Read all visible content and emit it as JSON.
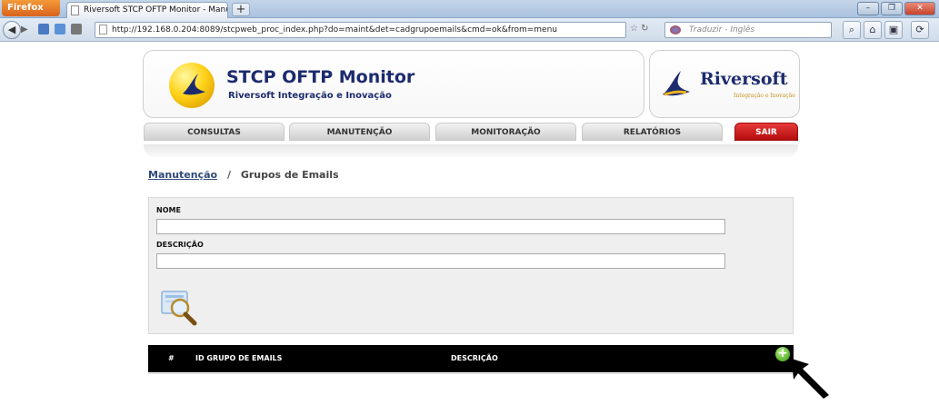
{
  "browser": {
    "firefox_button": "Firefox",
    "tab_title": "Riversoft STCP OFTP Monitor - Manuten...",
    "new_tab_label": "+",
    "url": "http://192.168.0.204:8089/stcpweb_proc_index.php?do=maint&det=cadgrupoemails&cmd=ok&from=menu",
    "search_placeholder": "Traduzir - Inglês"
  },
  "header": {
    "title": "STCP OFTP Monitor",
    "subtitle": "Riversoft Integração e Inovação",
    "partner_name": "Riversoft",
    "partner_tagline": "Integração e Inovação"
  },
  "menu": {
    "consultas": "CONSULTAS",
    "manutencao": "MANUTENÇÃO",
    "monitoracao": "MONITORAÇÃO",
    "relatorios": "RELATÓRIOS",
    "sair": "SAIR"
  },
  "breadcrumb": {
    "parent": "Manutenção",
    "separator": "/",
    "current": "Grupos de Emails"
  },
  "form": {
    "nome_label": "NOME",
    "nome_value": "",
    "descricao_label": "DESCRIÇÃO",
    "descricao_value": ""
  },
  "table": {
    "columns": [
      "#",
      "ID GRUPO DE EMAILS",
      "DESCRIÇÃO"
    ],
    "rows": []
  },
  "icons": {
    "search": "magnifier-icon",
    "add": "plus-circle-icon",
    "pointer": "arrow-cursor-icon"
  },
  "colors": {
    "brand_blue": "#1c2b6e",
    "exit_red": "#c21515",
    "table_header": "#000000",
    "add_green": "#58b22a"
  }
}
